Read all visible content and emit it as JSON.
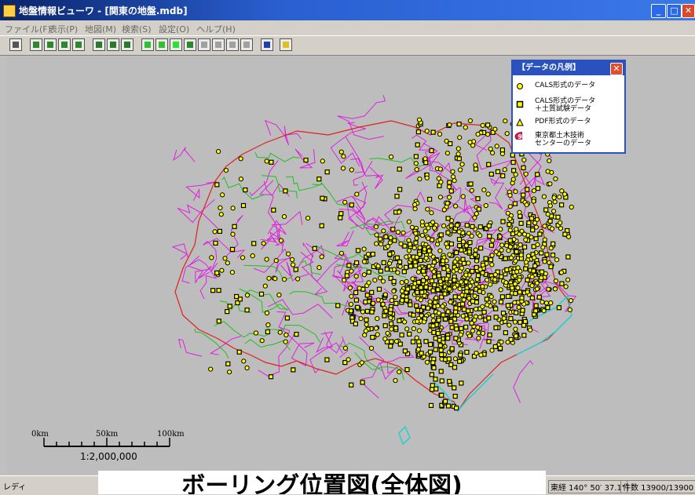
{
  "window": {
    "title": "地盤情報ビューワ - [関東の地盤.mdb]"
  },
  "menu": [
    "ファイル(F)",
    "表示(P)",
    "地図(M)",
    "検索(S)",
    "設定(O)",
    "ヘルプ(H)"
  ],
  "legend": {
    "title": "【データの凡例】",
    "items": [
      {
        "label": "CALS形式のデータ",
        "icon": "yellow-circle"
      },
      {
        "label": "CALS形式のデータ",
        "label2": "＋土質試験データ",
        "icon": "yellow-square"
      },
      {
        "label": "PDF形式のデータ",
        "icon": "yellow-triangle"
      },
      {
        "label": "東京都土木技術",
        "label2": "センターのデータ",
        "icon": "red-oval-99",
        "badge": "99"
      }
    ]
  },
  "scale": {
    "ticks": [
      "0km",
      "50km",
      "100km"
    ],
    "ratio": "1:2,000,000"
  },
  "status": {
    "left": "レディ",
    "coord": "東経 140° 50′ 37.1″",
    "count": "件数 13900/13900"
  },
  "caption": "ボーリング位置図(全体図)",
  "colors": {
    "prefecture_border": "#e02020",
    "municipal_border": "#e020e0",
    "river": "#20c020",
    "coast": "#20d0d0",
    "point_fill": "#ffff00"
  }
}
